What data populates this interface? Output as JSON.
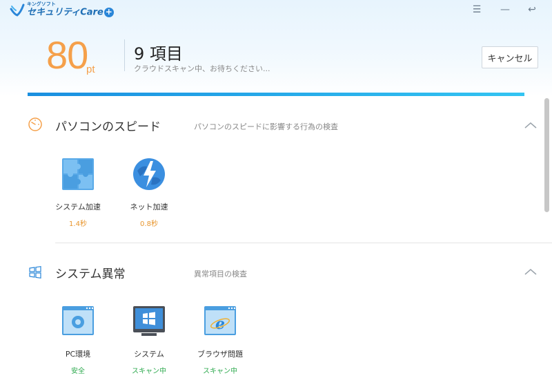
{
  "app": {
    "logo_small": "キングソフト",
    "logo_big": "セキュリティCare",
    "logo_plus": "+",
    "window_controls": {
      "menu": "☰",
      "minimize": "—",
      "restore": "↩"
    }
  },
  "scan": {
    "score": "80",
    "score_unit": "pt",
    "items_count": "9 項目",
    "status": "クラウドスキャン中、お待ちください...",
    "cancel_label": "キャンセル",
    "progress": 1.0,
    "progress_color_start": "#1a8fe0",
    "progress_color_end": "#33c4f2"
  },
  "sections": [
    {
      "title": "パソコンのスピード",
      "description": "パソコンのスピードに影響する行為の検査",
      "icon": "speedometer-icon",
      "items": [
        {
          "label": "システム加速",
          "value": "1.4秒",
          "icon": "puzzle-icon",
          "value_color": "#e8962e"
        },
        {
          "label": "ネット加速",
          "value": "0.8秒",
          "icon": "globe-lightning-icon",
          "value_color": "#e8962e"
        }
      ]
    },
    {
      "title": "システム異常",
      "description": "異常項目の検査",
      "icon": "windows-logo-icon",
      "items": [
        {
          "label": "PC環境",
          "value": "安全",
          "icon": "settings-window-icon",
          "value_color": "#2eaa4f"
        },
        {
          "label": "システム",
          "value": "スキャン中",
          "icon": "windows-monitor-icon",
          "value_color": "#2eaa4f"
        },
        {
          "label": "ブラウザ問題",
          "value": "スキャン中",
          "icon": "browser-ie-icon",
          "value_color": "#2eaa4f"
        }
      ]
    }
  ],
  "colors": {
    "accent_orange": "#f5a04a",
    "accent_blue": "#2a86d8",
    "status_green": "#2eaa4f"
  }
}
